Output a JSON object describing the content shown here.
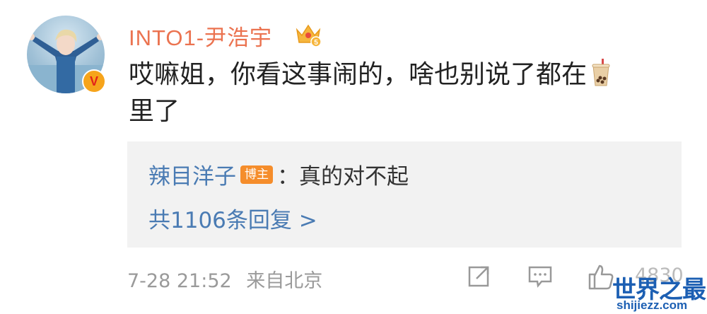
{
  "comment": {
    "username": "INTO1-尹浩宇",
    "text": "哎嘛姐，你看这事闹的，啥也别说了都在",
    "text_line2": "里了",
    "verified_badge": "V",
    "emoji": "bubble-tea-icon"
  },
  "reply": {
    "author": "辣目洋子",
    "author_tag": "博主",
    "separator": "：",
    "text": "真的对不起",
    "reply_count_label": "共1106条回复 >"
  },
  "meta": {
    "timestamp": "7-28 21:52",
    "source": "来自北京",
    "like_count": "4830"
  },
  "icons": [
    "share-icon",
    "comment-icon",
    "like-icon",
    "crown-level-icon"
  ],
  "watermark": {
    "title": "世界之最",
    "url": "shijiezz.com"
  },
  "colors": {
    "username": "#eb7350",
    "link_blue": "#4a7bb3",
    "reply_bg": "#f2f2f2",
    "meta_gray": "#9a9a9a",
    "watermark_blue": "#1c5fb3"
  }
}
